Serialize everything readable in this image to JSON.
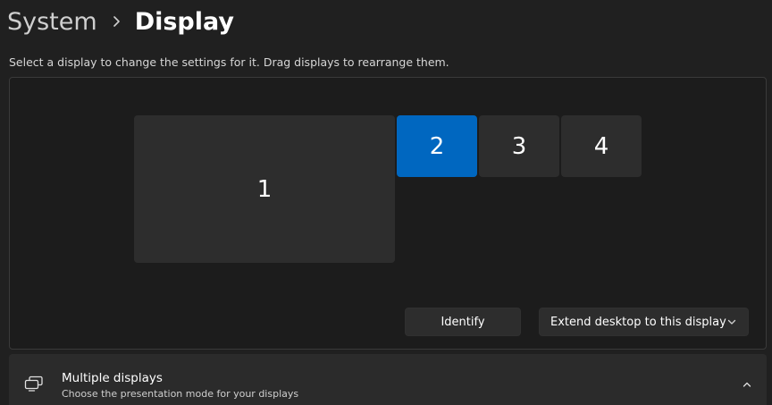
{
  "breadcrumb": {
    "parent": "System",
    "current": "Display"
  },
  "instructions": "Select a display to change the settings for it. Drag displays to rearrange them.",
  "displays": [
    {
      "label": "1",
      "selected": false
    },
    {
      "label": "2",
      "selected": true
    },
    {
      "label": "3",
      "selected": false
    },
    {
      "label": "4",
      "selected": false
    }
  ],
  "buttons": {
    "identify": "Identify",
    "extend_dropdown": "Extend desktop to this display"
  },
  "multiple_displays": {
    "title": "Multiple displays",
    "subtitle": "Choose the presentation mode for your displays",
    "expanded": true
  },
  "colors": {
    "accent": "#0067c0",
    "monitor": "#2d2d2d",
    "background": "#202020"
  },
  "icons": {
    "breadcrumb_separator": "chevron-right-icon",
    "dropdown": "chevron-down-icon",
    "section": "multiple-displays-icon",
    "section_toggle": "chevron-up-icon"
  }
}
